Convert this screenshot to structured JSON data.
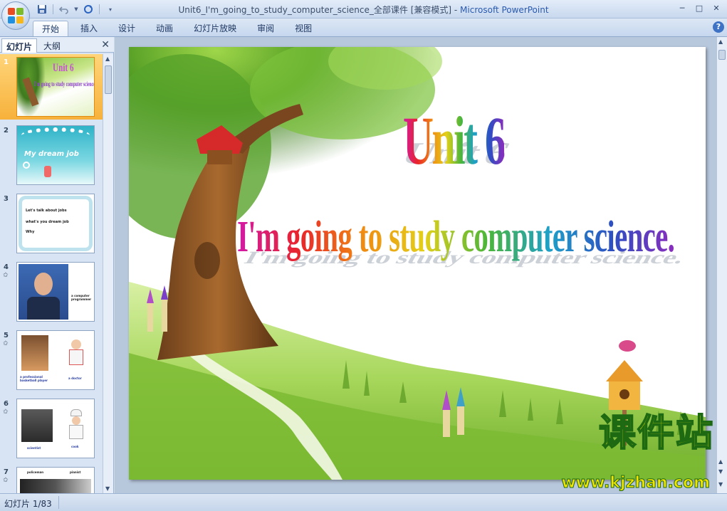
{
  "window": {
    "title_doc": "Unit6_I'm_going_to_study_computer_science_全部课件 [兼容模式]",
    "title_sep": " - ",
    "title_app": "Microsoft PowerPoint",
    "minimize": "─",
    "maximize": "□",
    "close": "✕"
  },
  "qat": {
    "save_icon": "save-icon",
    "undo_icon": "undo-icon",
    "redo_icon": "redo-icon",
    "customize_icon": "chevron-down-icon"
  },
  "ribbon": {
    "tabs": [
      {
        "label": "开始",
        "active": true
      },
      {
        "label": "插入"
      },
      {
        "label": "设计"
      },
      {
        "label": "动画"
      },
      {
        "label": "幻灯片放映"
      },
      {
        "label": "审阅"
      },
      {
        "label": "视图"
      }
    ],
    "help": "?"
  },
  "left_pane": {
    "tabs": [
      "幻灯片",
      "大纲"
    ],
    "close": "✕",
    "slides": [
      {
        "num": "1",
        "title": "Unit 6",
        "caption": "I'm going to study computer science"
      },
      {
        "num": "2",
        "caption": "My dream job"
      },
      {
        "num": "3",
        "bullets": [
          "Let's talk about jobs",
          "what's you dream job",
          "Why"
        ]
      },
      {
        "num": "4",
        "caption": "a computer programmer"
      },
      {
        "num": "5",
        "captions": [
          "a professional basketball player",
          "a doctor"
        ]
      },
      {
        "num": "6",
        "captions": [
          "scientist",
          "cook"
        ]
      },
      {
        "num": "7",
        "captions": [
          "policeman",
          "pianist"
        ]
      }
    ]
  },
  "slide": {
    "title": "Unit 6",
    "subtitle": "I'm going to study computer science."
  },
  "watermark": {
    "cn": "课件站",
    "url": "www.kjzhan.com"
  },
  "status": {
    "slide_counter": "幻灯片 1/83"
  }
}
